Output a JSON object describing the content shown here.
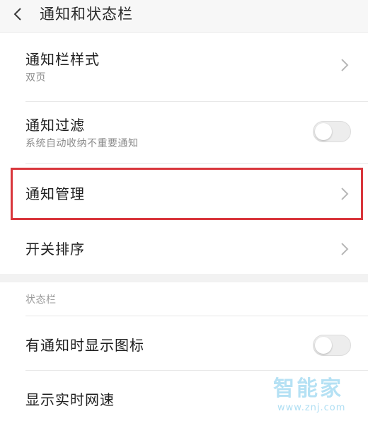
{
  "header": {
    "title": "通知和状态栏"
  },
  "rows": {
    "style": {
      "title": "通知栏样式",
      "subtitle": "双页"
    },
    "filter": {
      "title": "通知过滤",
      "subtitle": "系统自动收纳不重要通知",
      "toggle_on": false
    },
    "manage": {
      "title": "通知管理"
    },
    "order": {
      "title": "开关排序"
    },
    "show_icon": {
      "title": "有通知时显示图标",
      "toggle_on": false
    },
    "net_speed": {
      "title": "显示实时网速"
    }
  },
  "section": {
    "status_bar_label": "状态栏"
  },
  "watermark": {
    "text": "智能家",
    "url": "www.znj.com"
  },
  "colors": {
    "highlight": "#d9363c",
    "watermark": "#78c8eb"
  }
}
